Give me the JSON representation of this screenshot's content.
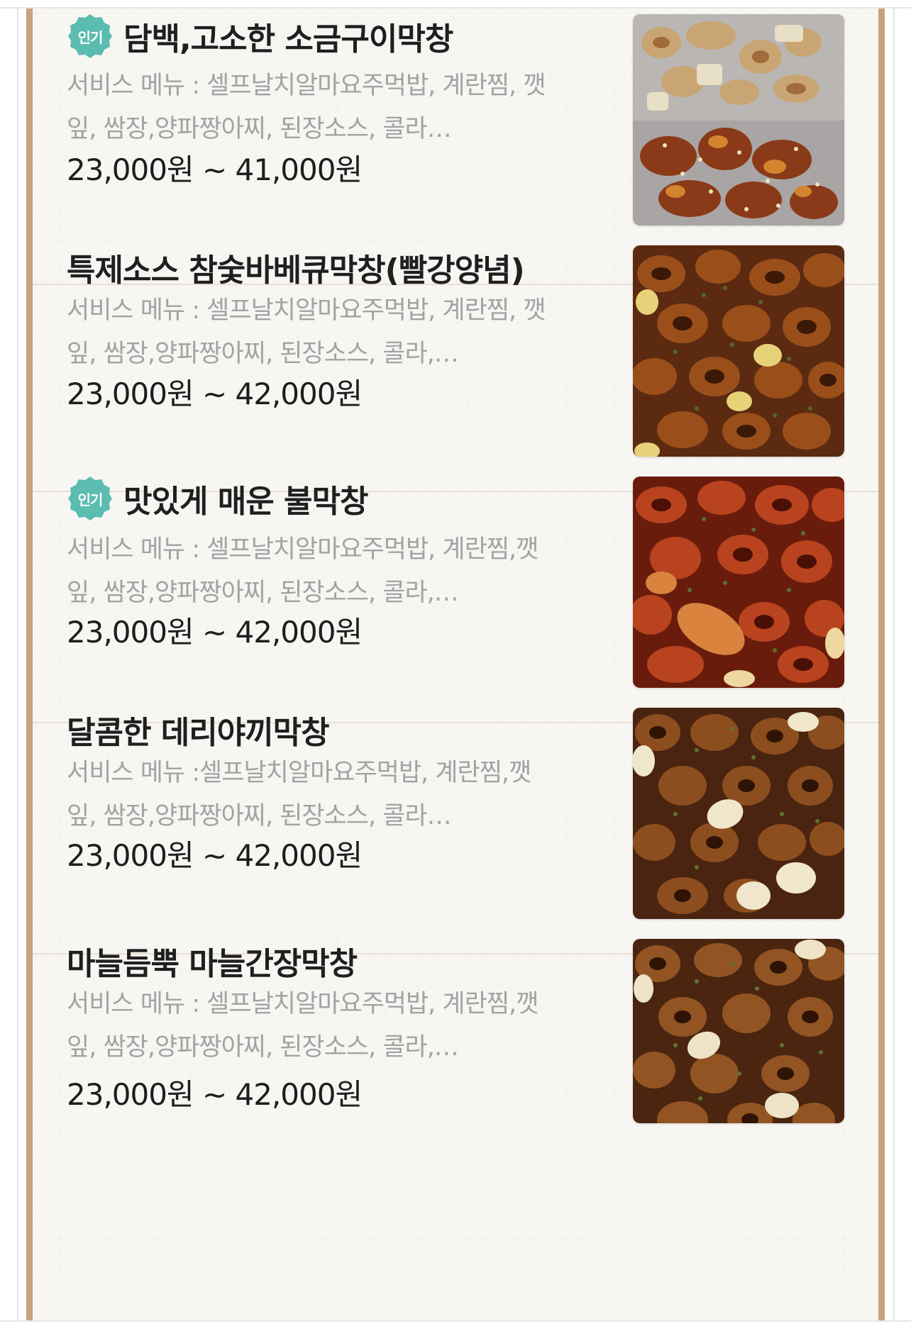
{
  "menu": {
    "items": [
      {
        "badge": "인기",
        "name": "담백,고소한 소금구이막창",
        "desc_line1": "서비스 메뉴 : 셀프날치알마요주먹밥, 계란찜, 깻",
        "desc_line2": "잎, 쌈장,양파짱아찌, 된장소스, 콜라…",
        "price": "23,000원 ~ 41,000원",
        "photo": "salt-grilled-makchang-photo"
      },
      {
        "badge": "",
        "name": "특제소스 참숯바베큐막창(빨강양념)",
        "desc_line1": "서비스 메뉴 : 셀프날치알마요주먹밥, 계란찜, 깻",
        "desc_line2": "잎, 쌈장,양파짱아찌, 된장소스, 콜라,…",
        "price": "23,000원 ~ 42,000원",
        "photo": "bbq-makchang-photo"
      },
      {
        "badge": "인기",
        "name": "맛있게 매운 불막창",
        "desc_line1": "서비스 메뉴 : 셀프날치알마요주먹밥, 계란찜,깻",
        "desc_line2": "잎, 쌈장,양파짱아찌, 된장소스, 콜라,…",
        "price": "23,000원 ~ 42,000원",
        "photo": "spicy-fire-makchang-photo"
      },
      {
        "badge": "",
        "name": "달콤한 데리야끼막창",
        "desc_line1": "서비스 메뉴 :셀프날치알마요주먹밥, 계란찜,깻",
        "desc_line2": "잎, 쌈장,양파짱아찌, 된장소스, 콜라…",
        "price": "23,000원 ~ 42,000원",
        "photo": "teriyaki-makchang-photo"
      },
      {
        "badge": "",
        "name": "마늘듬뿍 마늘간장막창",
        "desc_line1": "서비스 메뉴 : 셀프날치알마요주먹밥, 계란찜,깻",
        "desc_line2": "잎, 쌈장,양파짱아찌, 된장소스, 콜라,…",
        "price": "23,000원 ~ 42,000원",
        "photo": "garlic-soy-makchang-photo"
      }
    ]
  },
  "colors": {
    "badge": "#5bbcb0",
    "frame": "#c7a27d",
    "panel": "#f7f6f3",
    "title": "#1f1f1f",
    "desc": "#a3a3a3",
    "price": "#1e1e1e"
  }
}
